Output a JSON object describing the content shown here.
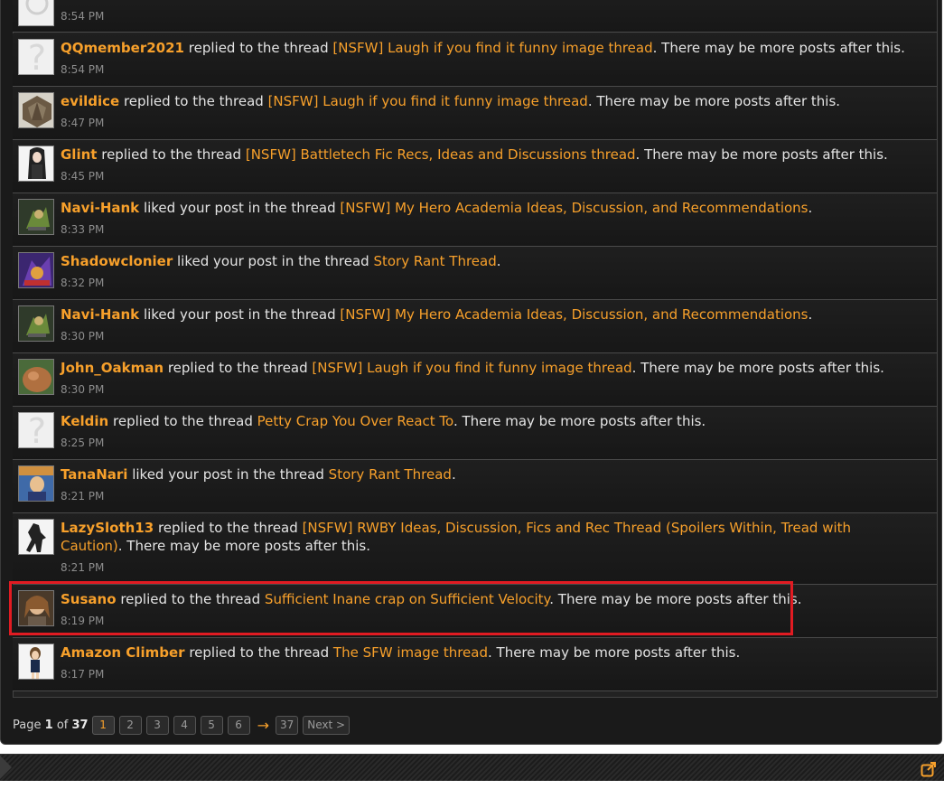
{
  "items": [
    {
      "time": "8:54 PM"
    },
    {
      "user": "QQmember2021",
      "action": "replied to the thread",
      "thread": "[NSFW] Laugh if you find it funny image thread",
      "suffix": ". There may be more posts after this.",
      "time": "8:54 PM"
    },
    {
      "user": "evildice",
      "action": "replied to the thread",
      "thread": "[NSFW] Laugh if you find it funny image thread",
      "suffix": ". There may be more posts after this.",
      "time": "8:47 PM"
    },
    {
      "user": "Glint",
      "action": "replied to the thread",
      "thread": "[NSFW] Battletech Fic Recs, Ideas and Discussions thread",
      "suffix": ". There may be more posts after this.",
      "time": "8:45 PM"
    },
    {
      "user": "Navi-Hank",
      "action": "liked your post in the thread",
      "thread": "[NSFW] My Hero Academia Ideas, Discussion, and Recommendations",
      "suffix": ".",
      "time": "8:33 PM"
    },
    {
      "user": "Shadowclonier",
      "action": "liked your post in the thread",
      "thread": "Story Rant Thread",
      "suffix": ".",
      "time": "8:32 PM"
    },
    {
      "user": "Navi-Hank",
      "action": "liked your post in the thread",
      "thread": "[NSFW] My Hero Academia Ideas, Discussion, and Recommendations",
      "suffix": ".",
      "time": "8:30 PM"
    },
    {
      "user": "John_Oakman",
      "action": "replied to the thread",
      "thread": "[NSFW] Laugh if you find it funny image thread",
      "suffix": ". There may be more posts after this.",
      "time": "8:30 PM"
    },
    {
      "user": "Keldin",
      "action": "replied to the thread",
      "thread": "Petty Crap You Over React To",
      "suffix": ". There may be more posts after this.",
      "time": "8:25 PM"
    },
    {
      "user": "TanaNari",
      "action": "liked your post in the thread",
      "thread": "Story Rant Thread",
      "suffix": ".",
      "time": "8:21 PM"
    },
    {
      "user": "LazySloth13",
      "action": "replied to the thread",
      "thread": "[NSFW] RWBY Ideas, Discussion, Fics and Rec Thread (Spoilers Within, Tread with Caution)",
      "suffix": ". There may be more posts after this.",
      "time": "8:21 PM"
    },
    {
      "user": "Susano",
      "action": "replied to the thread",
      "thread": "Sufficient Inane crap on Sufficient Velocity",
      "suffix": ". There may be more posts after this.",
      "time": "8:19 PM"
    },
    {
      "user": "Amazon Climber",
      "action": "replied to the thread",
      "thread": "The SFW image thread",
      "suffix": ". There may be more posts after this.",
      "time": "8:17 PM"
    }
  ],
  "pager": {
    "label_prefix": "Page",
    "current": "1",
    "of_word": "of",
    "total": "37",
    "pages": [
      "1",
      "2",
      "3",
      "4",
      "5",
      "6"
    ],
    "arrow": "→",
    "last": "37",
    "next": "Next >"
  },
  "colors": {
    "accent": "#f7a02b",
    "highlight": "#e11b22",
    "background": "#1a1a1a"
  }
}
